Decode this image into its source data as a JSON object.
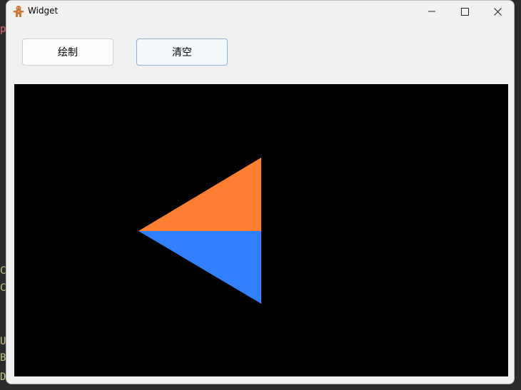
{
  "window": {
    "title": "Widget",
    "app_icon": "gingerbread-icon",
    "controls": {
      "minimize_icon": "minimize-icon",
      "maximize_icon": "maximize-icon",
      "close_icon": "close-icon"
    }
  },
  "toolbar": {
    "draw_label": "绘制",
    "clear_label": "清空"
  },
  "canvas": {
    "background": "#000000",
    "shapes": [
      {
        "name": "orange-triangle",
        "color": "#ff7f32"
      },
      {
        "name": "blue-triangle",
        "color": "#3380ff"
      }
    ]
  },
  "background_fragments": [
    "p",
    "C",
    "C",
    "U",
    "B",
    "D"
  ]
}
